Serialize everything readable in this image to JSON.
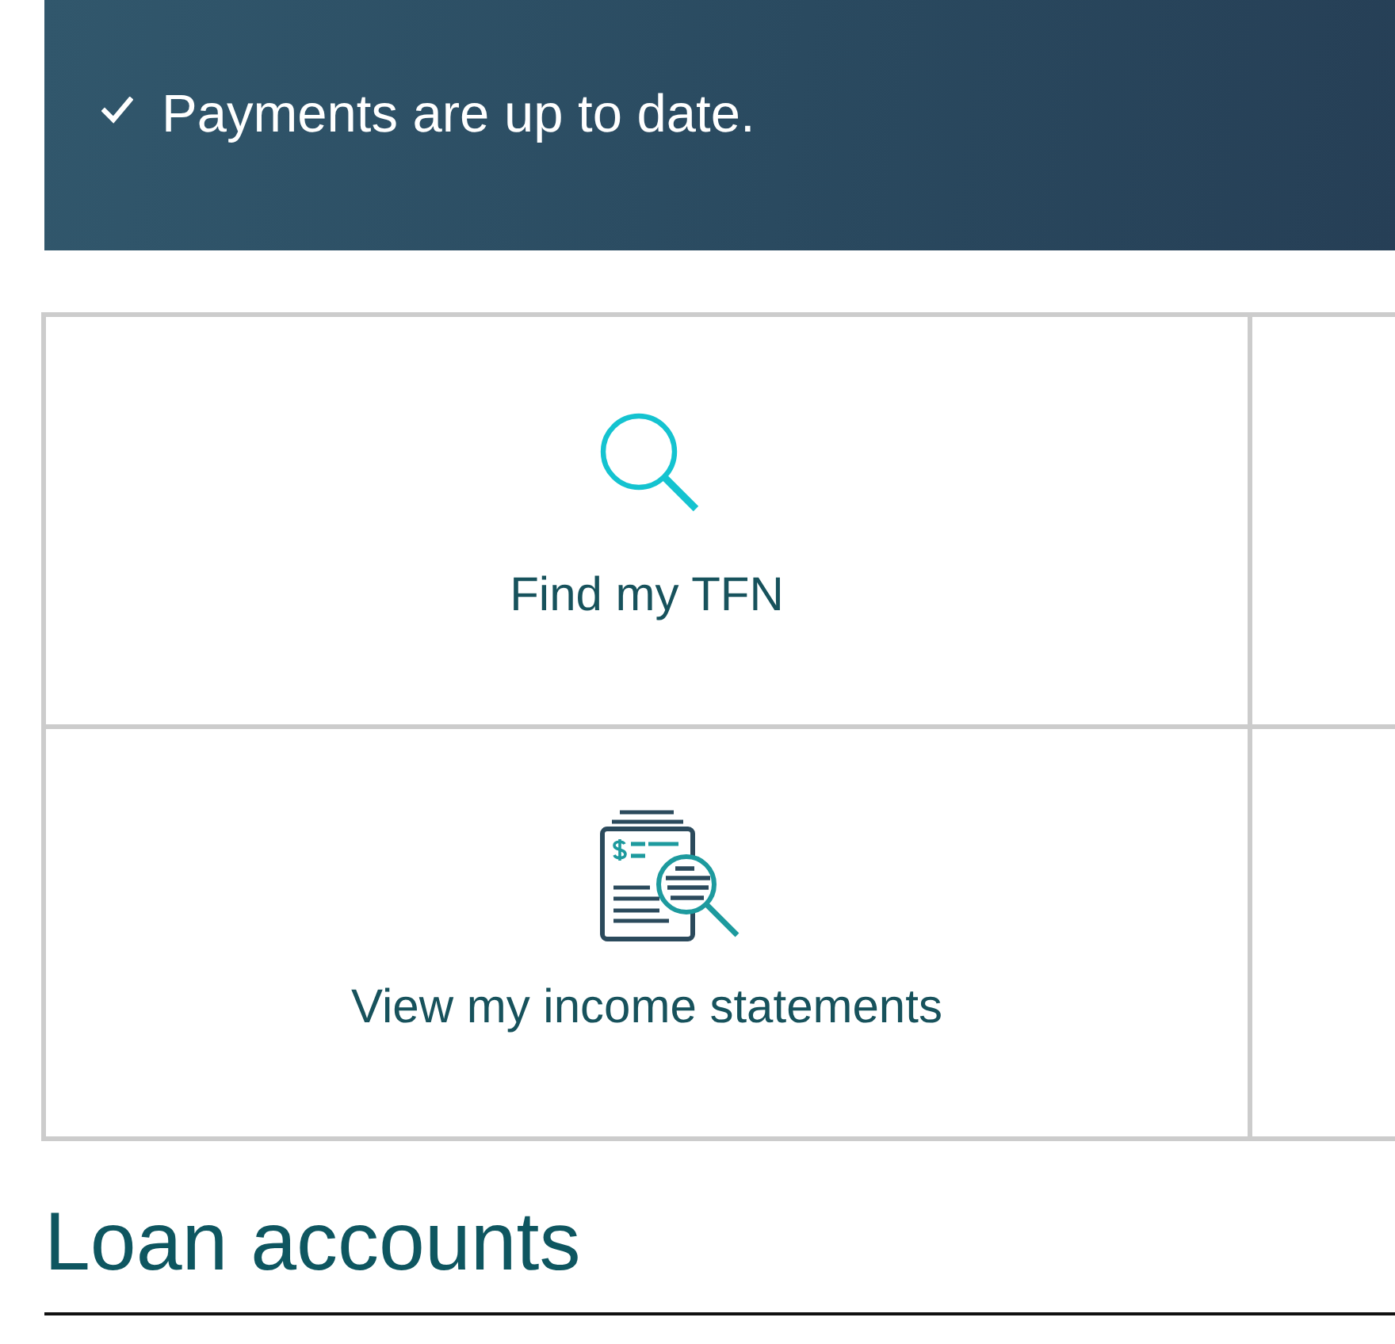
{
  "banner": {
    "kind": "success",
    "message": "Payments are up to date."
  },
  "tiles": [
    {
      "kind": "search",
      "label": "Find my TFN"
    },
    {
      "kind": "statements",
      "label": "View my income statements"
    }
  ],
  "section": {
    "title": "Loan accounts"
  }
}
